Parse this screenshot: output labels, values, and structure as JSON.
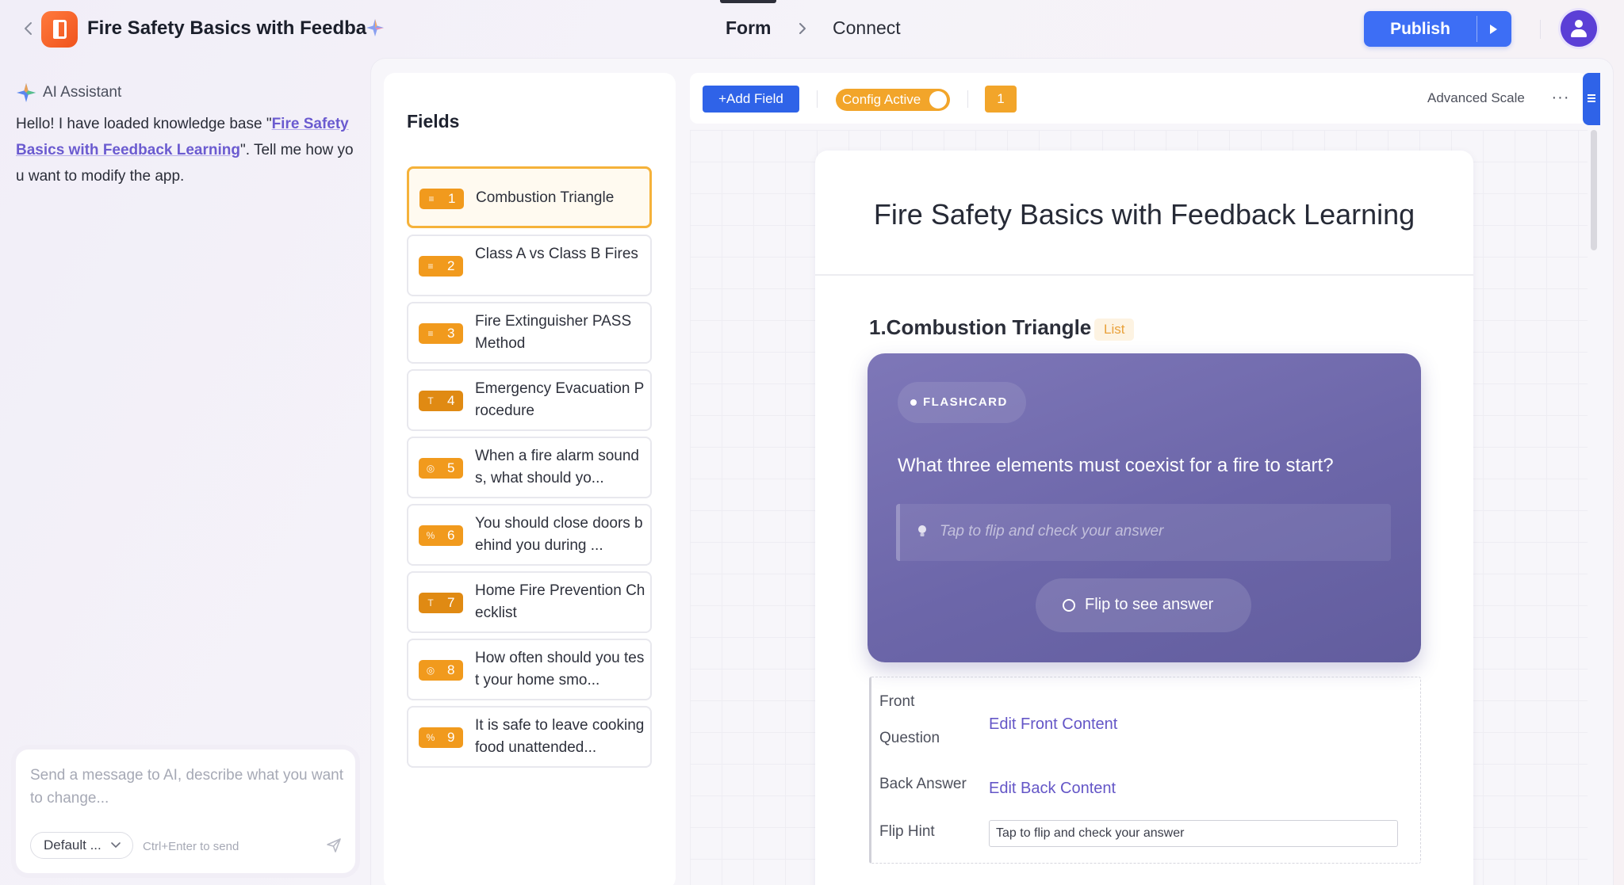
{
  "header": {
    "app_title": "Fire Safety Basics with Feedba",
    "tabs": [
      {
        "label": "Form",
        "active": true
      },
      {
        "label": "Connect",
        "active": false
      }
    ],
    "publish_label": "Publish"
  },
  "ai_panel": {
    "title": "AI Assistant",
    "message_prefix": "Hello! I have loaded knowledge base \"",
    "message_link": "Fire Safety Basics with Feedback Learning",
    "message_suffix": "\". Tell me how you want to modify the app.",
    "input_placeholder": "Send a message to AI, describe what you want to change...",
    "model_select": "Default ...",
    "send_hint": "Ctrl+Enter to send"
  },
  "fields": {
    "title": "Fields",
    "items": [
      {
        "num": "1",
        "label": "Combustion Triangle",
        "icon": "list-icon",
        "active": true
      },
      {
        "num": "2",
        "label": "Class A vs Class B Fires",
        "icon": "list-icon"
      },
      {
        "num": "3",
        "label": "Fire Extinguisher PASS Method",
        "icon": "list-icon"
      },
      {
        "num": "4",
        "label": "Emergency Evacuation Procedure",
        "icon": "text-icon"
      },
      {
        "num": "5",
        "label": "When a fire alarm sounds, what should yo...",
        "icon": "radio-icon"
      },
      {
        "num": "6",
        "label": "You should close doors behind you during ...",
        "icon": "percent-icon"
      },
      {
        "num": "7",
        "label": "Home Fire Prevention Checklist",
        "icon": "text-icon"
      },
      {
        "num": "8",
        "label": "How often should you test your home smo...",
        "icon": "radio-icon"
      },
      {
        "num": "9",
        "label": "It is safe to leave cooking food unattended...",
        "icon": "percent-icon"
      }
    ]
  },
  "toolbar": {
    "add_field_label": "+Add Field",
    "config_label": "Config Active",
    "count": "1",
    "advanced_scale_label": "Advanced Scale"
  },
  "form": {
    "title": "Fire Safety Basics with Feedback Learning",
    "question_title": "1.Combustion Triangle",
    "question_tag": "List",
    "flashcard": {
      "chip": "FLASHCARD",
      "question": "What three elements must coexist for a fire to start?",
      "hint": "Tap to flip and check your answer",
      "flip_label": "Flip to see answer"
    },
    "props": {
      "front_label_1": "Front",
      "front_label_2": "Question",
      "front_link": "Edit Front Content",
      "back_label": "Back Answer",
      "back_link": "Edit Back Content",
      "flip_hint_label": "Flip Hint",
      "flip_hint_value": "Tap to flip and check your answer"
    }
  },
  "colors": {
    "accent_blue": "#3d6ef5",
    "badge_orange": "#f19a1d",
    "flashcard_purple": "#6c66a9",
    "avatar_purple": "#5b3fd6"
  }
}
